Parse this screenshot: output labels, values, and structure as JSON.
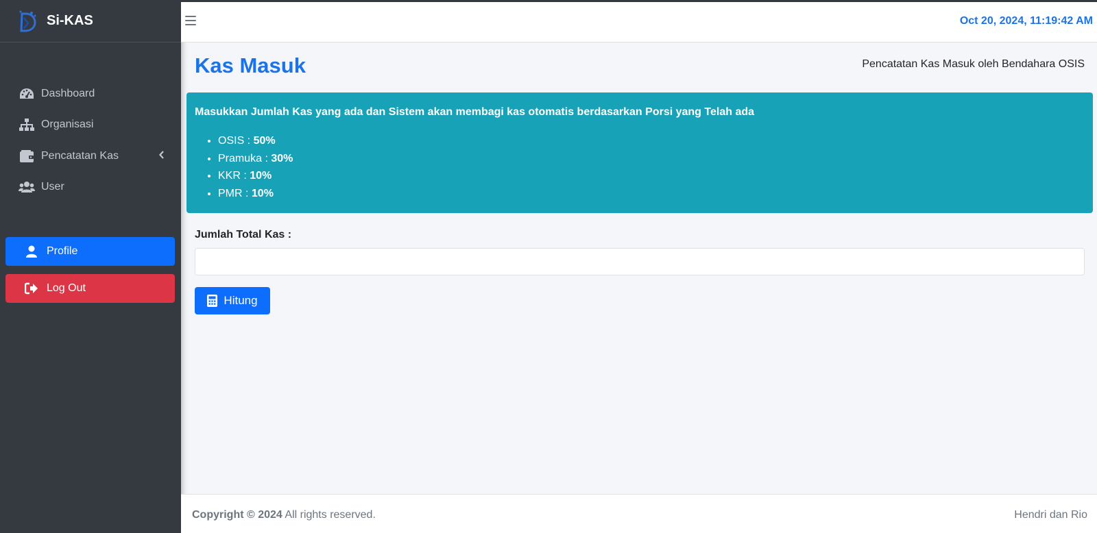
{
  "app": {
    "brand_name": "Si-KAS"
  },
  "sidebar": {
    "items": [
      {
        "label": "Dashboard",
        "icon": "tachometer-icon"
      },
      {
        "label": "Organisasi",
        "icon": "sitemap-icon"
      },
      {
        "label": "Pencatatan Kas",
        "icon": "wallet-icon",
        "has_submenu": true
      },
      {
        "label": "User",
        "icon": "users-icon"
      }
    ],
    "profile_label": "Profile",
    "logout_label": "Log Out"
  },
  "header": {
    "datetime": "Oct 20, 2024, 11:19:42 AM"
  },
  "page": {
    "title": "Kas Masuk",
    "subtitle": "Pencatatan Kas Masuk oleh Bendahara OSIS"
  },
  "info": {
    "title": "Masukkan Jumlah Kas yang ada dan Sistem akan membagi kas otomatis berdasarkan Porsi yang Telah ada",
    "portions": [
      {
        "name": "OSIS",
        "sep": " : ",
        "pct": "50%"
      },
      {
        "name": "Pramuka",
        "sep": " : ",
        "pct": "30%"
      },
      {
        "name": "KKR",
        "sep": " : ",
        "pct": "10%"
      },
      {
        "name": "PMR",
        "sep": " : ",
        "pct": "10%"
      }
    ]
  },
  "form": {
    "total_label": "Jumlah Total Kas :",
    "total_value": "",
    "submit_label": "Hitung"
  },
  "footer": {
    "copyright": "Copyright © 2024",
    "rights": " All rights reserved.",
    "credits": "Hendri dan Rio"
  },
  "colors": {
    "sidebar_bg": "#343a40",
    "accent_blue": "#1a73e8",
    "primary": "#0d6efd",
    "danger": "#dc3545",
    "info": "#17a2b8"
  }
}
